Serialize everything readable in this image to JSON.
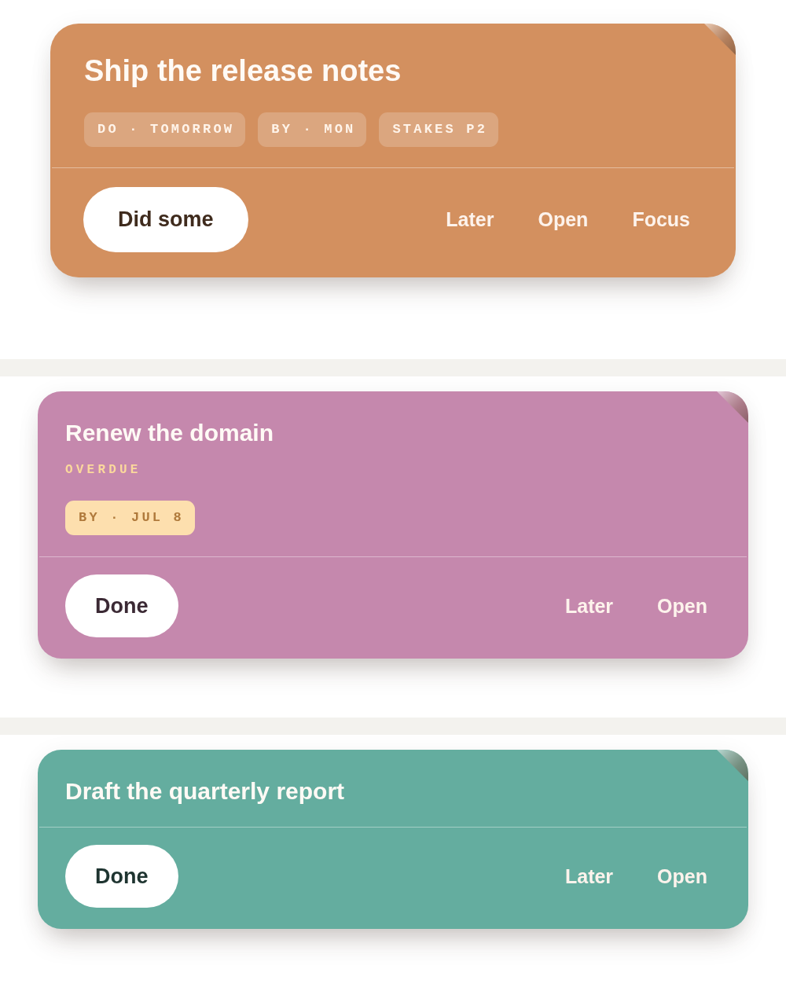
{
  "cards": [
    {
      "kind": "hero",
      "color": "#d3905f",
      "title": "Ship the release notes",
      "chips": [
        {
          "kind": "plain",
          "label": "DO · TOMORROW"
        },
        {
          "kind": "plain",
          "label": "BY · MON"
        },
        {
          "kind": "plain",
          "label": "STAKES P2"
        }
      ],
      "primary_action": "Did some",
      "actions": [
        "Later",
        "Open",
        "Focus"
      ]
    },
    {
      "kind": "compact",
      "color": "#c588ad",
      "title": "Renew the domain",
      "status": "OVERDUE",
      "chips": [
        {
          "kind": "alert",
          "label": "BY · JUL 8"
        }
      ],
      "primary_action": "Done",
      "actions": [
        "Later",
        "Open"
      ]
    },
    {
      "kind": "compact",
      "color": "#64ad9f",
      "title": "Draft the quarterly report",
      "primary_action": "Done",
      "actions": [
        "Later",
        "Open"
      ]
    }
  ]
}
